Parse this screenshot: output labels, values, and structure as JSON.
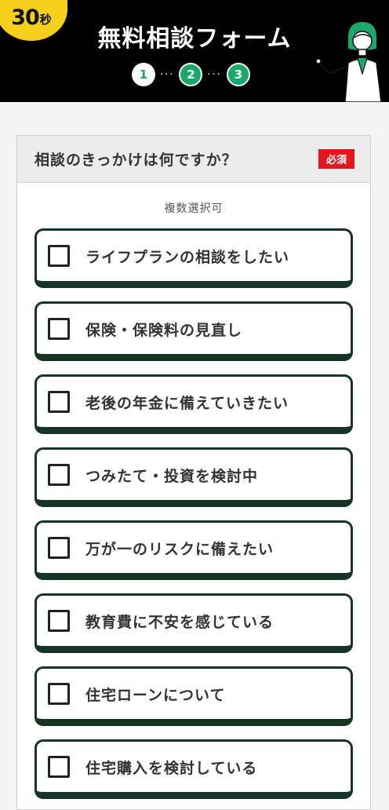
{
  "header": {
    "badge_num": "30",
    "badge_unit": "秒",
    "title": "無料相談フォーム",
    "steps": [
      "1",
      "2",
      "3"
    ],
    "colors": {
      "header_bg": "#000000",
      "badge": "#f5cf1c",
      "accent": "#1aa86b"
    }
  },
  "question": {
    "text": "相談のきっかけは何ですか？",
    "required_label": "必須",
    "sub": "複数選択可",
    "options": [
      "ライフプランの相談をしたい",
      "保険・保険料の見直し",
      "老後の年金に備えていきたい",
      "つみたて・投資を検討中",
      "万が一のリスクに備えたい",
      "教育費に不安を感じている",
      "住宅ローンについて",
      "住宅購入を検討している"
    ]
  }
}
